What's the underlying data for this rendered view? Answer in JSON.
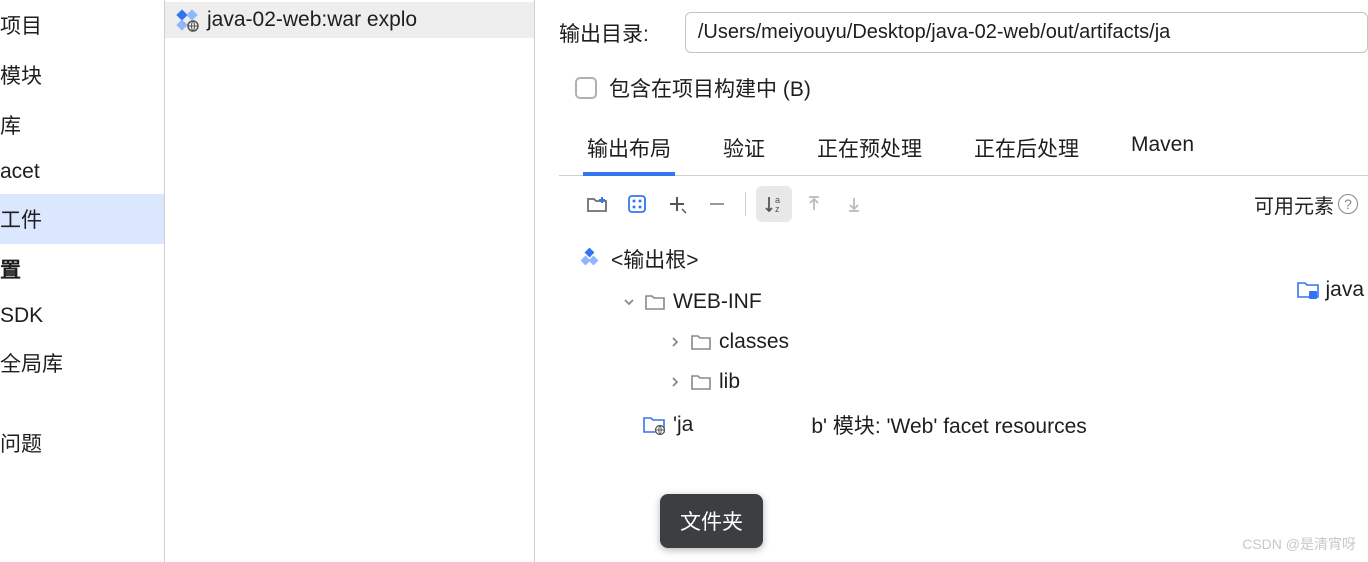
{
  "sidebar": {
    "items": [
      {
        "label": "项目"
      },
      {
        "label": "模块"
      },
      {
        "label": "库"
      },
      {
        "label": "acet"
      },
      {
        "label": "工件"
      },
      {
        "label": "置"
      },
      {
        "label": "SDK"
      },
      {
        "label": "全局库"
      },
      {
        "label": "问题"
      }
    ]
  },
  "artifact": {
    "name": "java-02-web:war explo"
  },
  "output": {
    "label": "输出目录:",
    "path": "/Users/meiyouyu/Desktop/java-02-web/out/artifacts/ja",
    "include_label": "包含在项目构建中 (B)"
  },
  "tabs": [
    {
      "label": "输出布局",
      "active": true
    },
    {
      "label": "验证"
    },
    {
      "label": "正在预处理"
    },
    {
      "label": "正在后处理"
    },
    {
      "label": "Maven"
    }
  ],
  "available_label": "可用元素",
  "tree": {
    "root": "<输出根>",
    "webinf": "WEB-INF",
    "classes": "classes",
    "lib": "lib",
    "module_row_prefix": "'ja",
    "module_row_suffix": "b' 模块: 'Web' facet resources"
  },
  "available_items": [
    {
      "label": "java"
    }
  ],
  "tooltip": "文件夹",
  "watermark": "CSDN @是清宵呀"
}
